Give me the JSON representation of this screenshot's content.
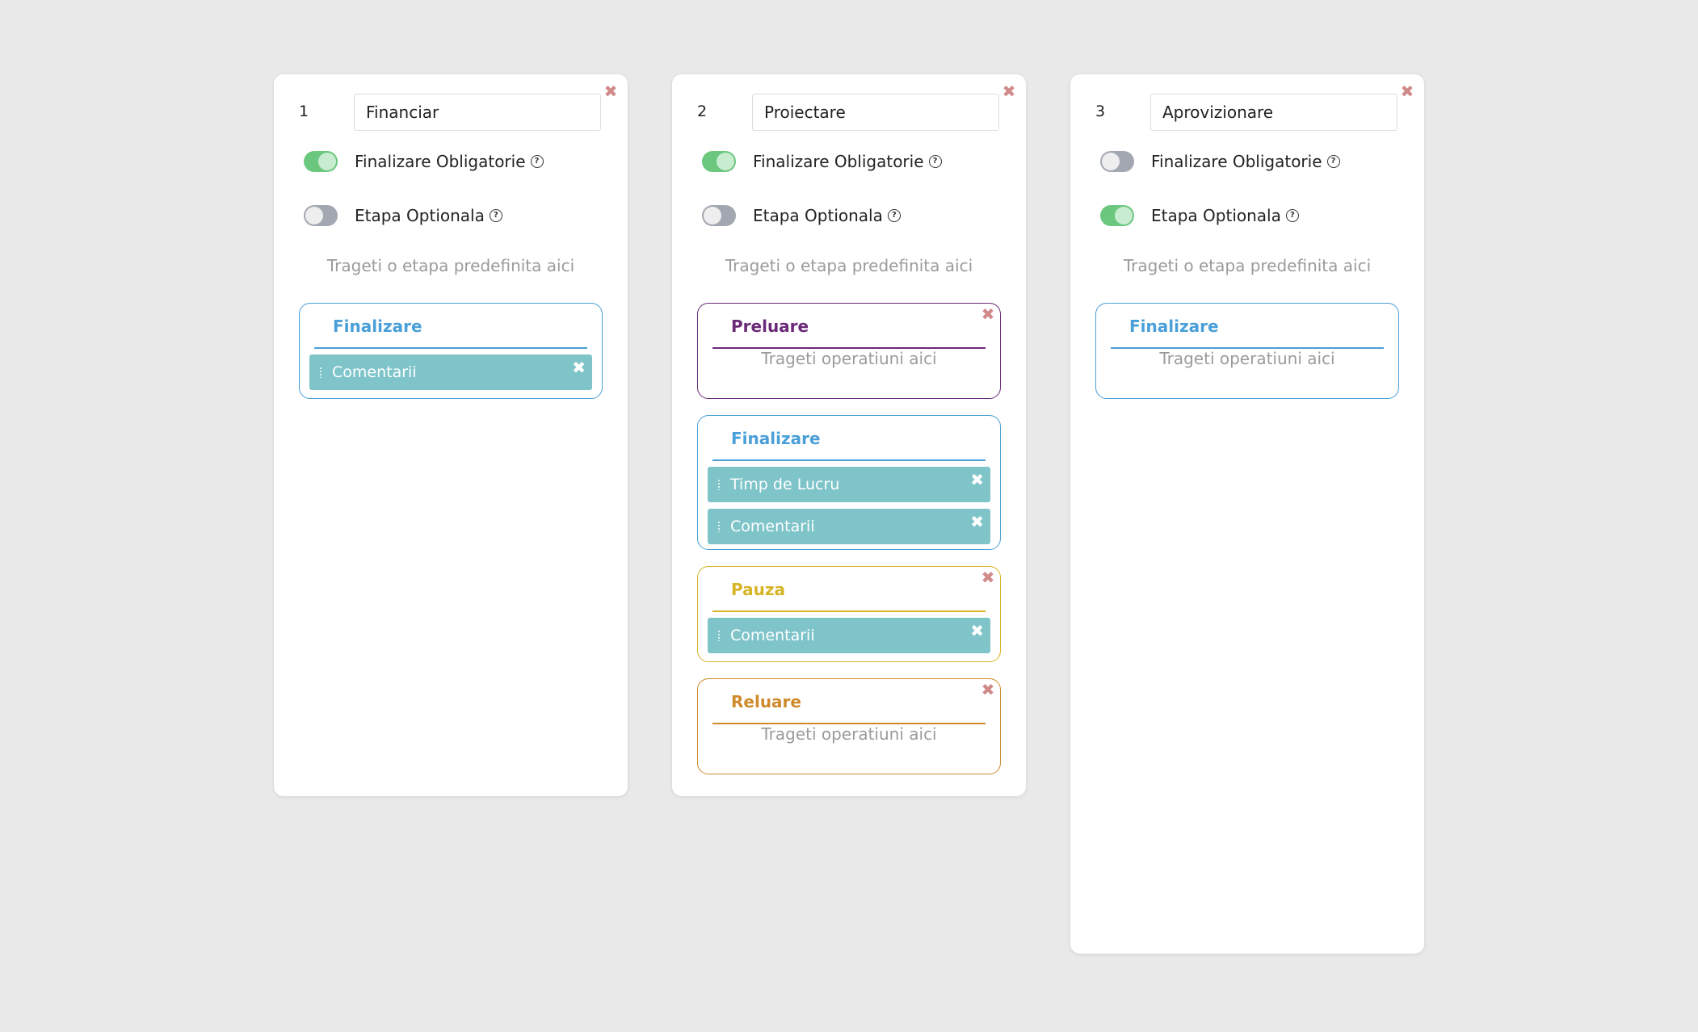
{
  "cards": [
    {
      "number": "1",
      "name": "Financiar",
      "toggle1_label": "Finalizare Obligatorie",
      "toggle2_label": "Etapa Optionala",
      "drop_hint": "Trageti o etapa predefinita aici",
      "stages": [
        {
          "title": "Finalizare",
          "operations": [
            "Comentarii"
          ]
        }
      ]
    },
    {
      "number": "2",
      "name": "Proiectare",
      "toggle1_label": "Finalizare Obligatorie",
      "toggle2_label": "Etapa Optionala",
      "drop_hint": "Trageti o etapa predefinita aici",
      "stages": [
        {
          "title": "Preluare",
          "ops_hint": "Trageti operatiuni aici"
        },
        {
          "title": "Finalizare",
          "operations": [
            "Timp de Lucru",
            "Comentarii"
          ]
        },
        {
          "title": "Pauza",
          "operations": [
            "Comentarii"
          ]
        },
        {
          "title": "Reluare",
          "ops_hint": "Trageti operatiuni aici"
        }
      ]
    },
    {
      "number": "3",
      "name": "Aprovizionare",
      "toggle1_label": "Finalizare Obligatorie",
      "toggle2_label": "Etapa Optionala",
      "drop_hint": "Trageti o etapa predefinita aici",
      "stages": [
        {
          "title": "Finalizare",
          "ops_hint": "Trageti operatiuni aici"
        }
      ]
    }
  ],
  "toggles": {
    "card1_finalizare_obligatorie": "on",
    "card1_etapa_optionala": "off",
    "card2_finalizare_obligatorie": "on",
    "card2_etapa_optionala": "off",
    "card3_finalizare_obligatorie": "off",
    "card3_etapa_optionala": "on"
  },
  "icons": {
    "close": "close-icon",
    "help": "help-circle-icon",
    "grip": "drag-handle-icon"
  },
  "colors": {
    "background": "#e9e9e9",
    "toggle_on": "#6cc77e",
    "toggle_off": "#a2a7b1",
    "operation_bg": "#7ec4c9",
    "close_icon": "#d08a8a",
    "stage_finalizare": "#4a9fd8",
    "stage_preluare": "#6b2a78",
    "stage_pauza": "#d6b424",
    "stage_reluare": "#cf8a2c",
    "hint_text": "#9b9b9b"
  }
}
